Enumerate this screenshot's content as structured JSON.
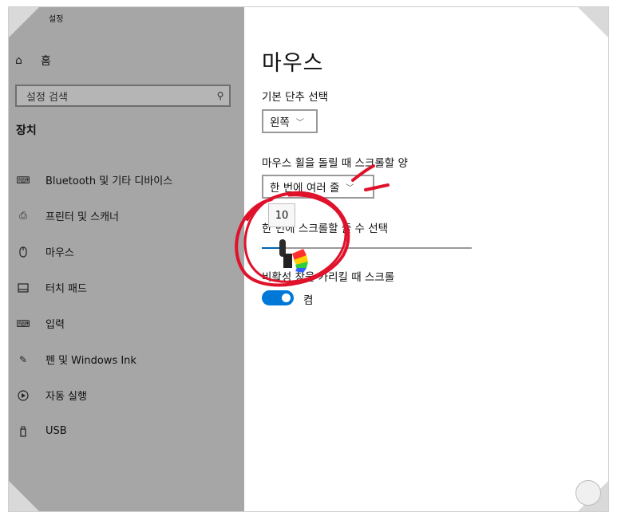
{
  "window": {
    "title": "설정",
    "back_icon": "back-arrow-icon"
  },
  "sidebar": {
    "home_label": "홈",
    "search_placeholder": "설정 검색",
    "section_title": "장치",
    "items": [
      {
        "label": "Bluetooth 및 기타 디바이스",
        "icon": "bluetooth-devices-icon"
      },
      {
        "label": "프린터 및 스캐너",
        "icon": "printer-icon"
      },
      {
        "label": "마우스",
        "icon": "mouse-icon"
      },
      {
        "label": "터치 패드",
        "icon": "touchpad-icon"
      },
      {
        "label": "입력",
        "icon": "keyboard-icon"
      },
      {
        "label": "펜 및 Windows Ink",
        "icon": "pen-icon"
      },
      {
        "label": "자동 실행",
        "icon": "autoplay-icon"
      },
      {
        "label": "USB",
        "icon": "usb-icon"
      }
    ],
    "selected_index": 2
  },
  "main": {
    "title": "마우스",
    "primary_button": {
      "label": "기본 단추 선택",
      "value": "왼쪽"
    },
    "scroll_amount": {
      "label": "마우스 휠을 돌릴 때 스크롤할 양",
      "value": "한 번에 여러 줄"
    },
    "lines_to_scroll": {
      "label": "한 번에 스크롤할 줄 수 선택",
      "value": "10",
      "fraction": 0.1
    },
    "inactive_scroll": {
      "label": "비활성 창을 가리킬 때 스크롤",
      "state_label": "켬",
      "on": true
    }
  },
  "colors": {
    "sidebar_bg": "#a6a6a6",
    "accent": "#0078d7",
    "annotation": "#e0112b"
  }
}
